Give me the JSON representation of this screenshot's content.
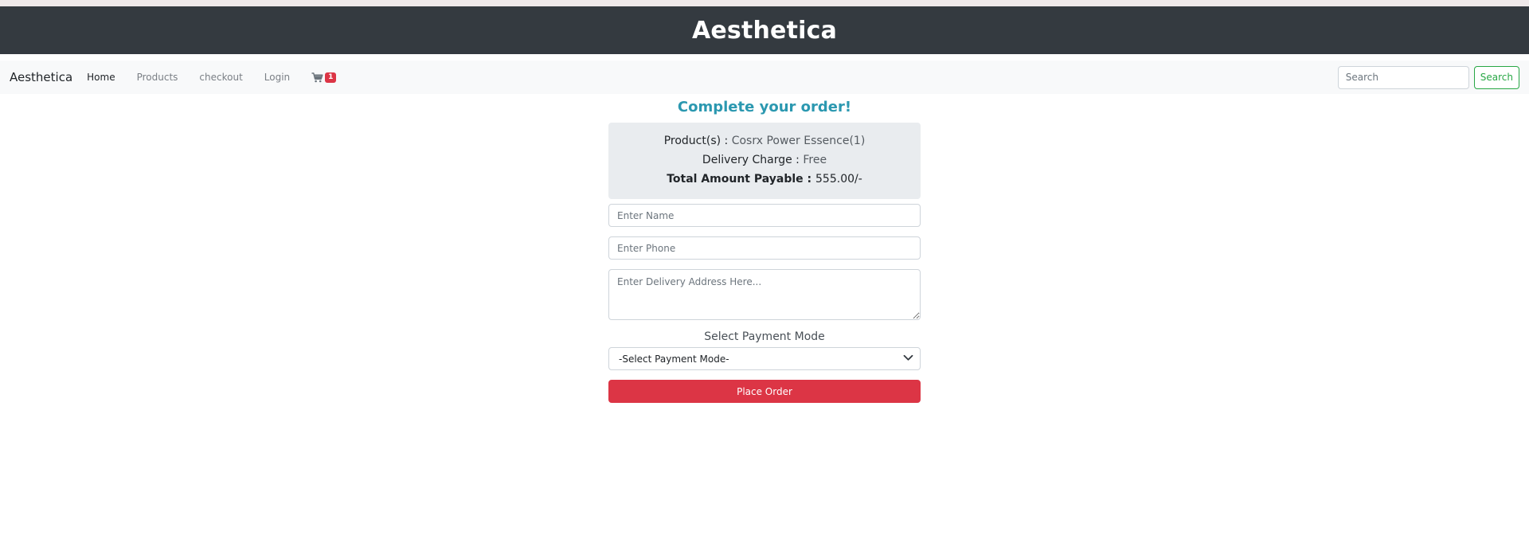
{
  "site": {
    "banner_title": "Aesthetica"
  },
  "navbar": {
    "brand": "Aesthetica",
    "links": [
      {
        "label": "Home",
        "active": true
      },
      {
        "label": "Products",
        "active": false
      },
      {
        "label": "checkout",
        "active": false
      },
      {
        "label": "Login",
        "active": false
      }
    ],
    "cart": {
      "icon": "cart-icon",
      "count": "1",
      "badge_color": "#dc3545"
    },
    "search": {
      "placeholder": "Search",
      "button_label": "Search",
      "button_color": "#28a745"
    }
  },
  "order": {
    "title": "Complete your order!",
    "title_color": "#2b98b0",
    "summary": {
      "products_label": "Product(s) : ",
      "products_value": "Cosrx Power Essence(1)",
      "delivery_label": "Delivery Charge : ",
      "delivery_value": "Free",
      "total_label": "Total Amount Payable : ",
      "total_value": "555.00/-"
    },
    "form": {
      "name_placeholder": "Enter Name",
      "phone_placeholder": "Enter Phone",
      "address_placeholder": "Enter Delivery Address Here...",
      "payment_label": "Select Payment Mode",
      "payment_selected": "-Select Payment Mode-",
      "submit_label": "Place Order",
      "submit_color": "#dc3545"
    }
  }
}
